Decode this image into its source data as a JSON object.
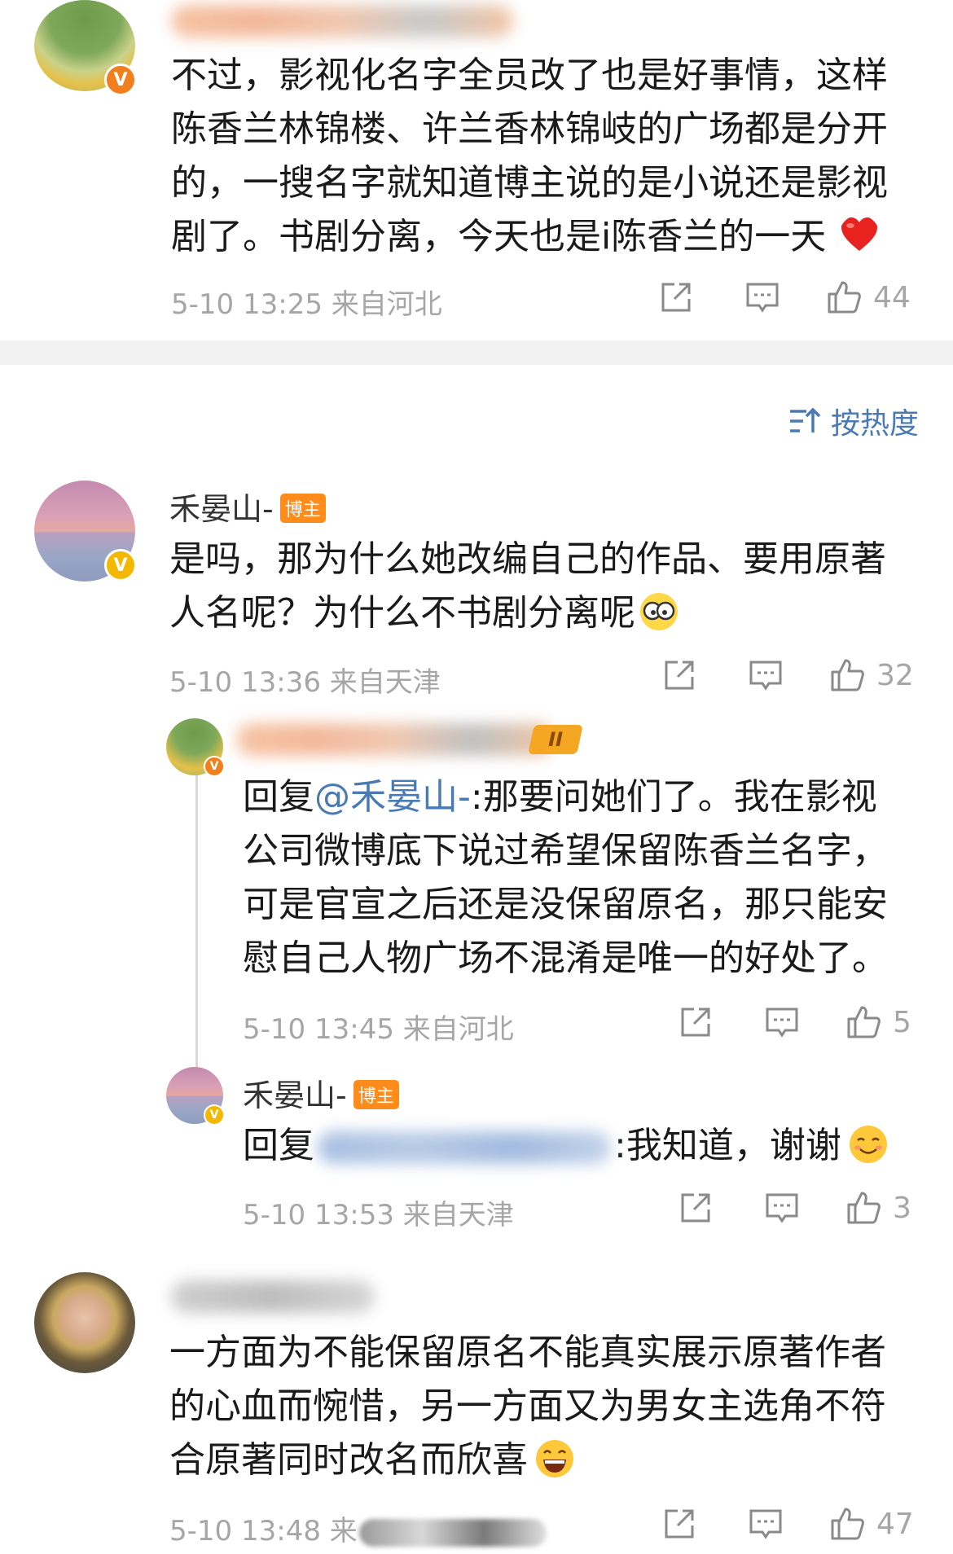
{
  "comments": [
    {
      "name_blurred": true,
      "lines": [
        "不过，影视化名字全员改了也是好事情，这样",
        "陈香兰林锦楼、许兰香林锦岐的广场都是分开",
        "的，一搜名字就知道博主说的是小说还是影视",
        "剧了。书剧分离，今天也是i陈香兰的一天"
      ],
      "meta": "5-10 13:25 来自河北",
      "likes": "44"
    },
    {
      "name": "禾晏山-",
      "tag": "博主",
      "lines": [
        "是吗，那为什么她改编自己的作品、要用原著",
        "人名呢？为什么不书剧分离呢"
      ],
      "meta": "5-10 13:36 来自天津",
      "likes": "32"
    },
    {
      "name": "",
      "lines": [
        "",
        "公司微博底下说过希望保留陈香兰名字，",
        "可是官宣之后还是没保留原名，那只能安",
        "慰自己人物广场不混淆是唯一的好处了。"
      ],
      "reply_prefix": "回复",
      "reply_mention": "@禾晏山-",
      "reply_rest": ":那要问她们了。我在影视",
      "meta": "5-10 13:45 来自河北",
      "likes": "5"
    },
    {
      "name": "禾晏山-",
      "tag": "博主",
      "reply_prefix": "回复",
      "reply_rest": ":我知道，谢谢",
      "meta": "5-10 13:53 来自天津",
      "likes": "3"
    },
    {
      "name_blurred": true,
      "lines": [
        "一方面为不能保留原名不能真实展示原著作者",
        "的心血而惋惜，另一方面又为男女主选角不符",
        "合原著同时改名而欣喜"
      ],
      "meta": "5-10 13:48 来",
      "likes": "47"
    }
  ],
  "sort_label": "按热度",
  "colors": {
    "link": "#4a7ab3",
    "meta": "#a6a6a6",
    "blogger_tag": "#ff8b1a"
  },
  "icons": [
    "share-icon",
    "comment-icon",
    "like-icon",
    "sort-icon",
    "heart-emoji",
    "doge-emoji",
    "smile-emoji",
    "grin-emoji"
  ]
}
